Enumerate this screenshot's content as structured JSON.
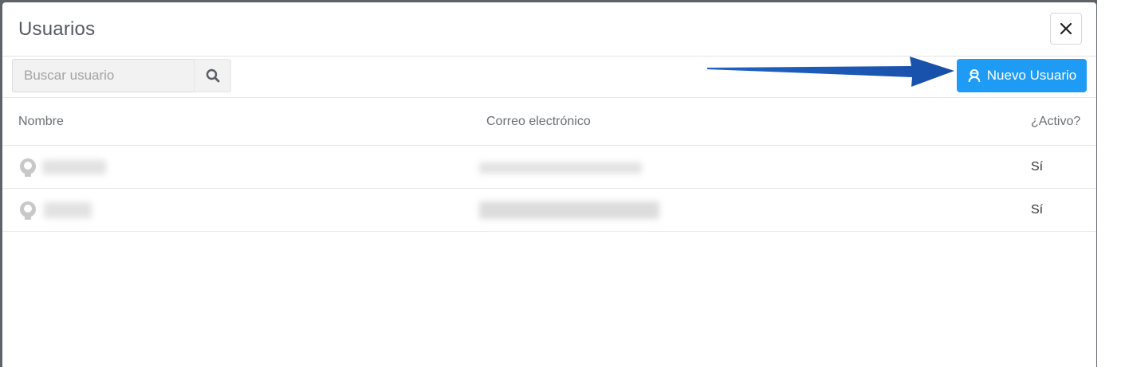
{
  "modal": {
    "title": "Usuarios",
    "close_icon": "close-icon"
  },
  "toolbar": {
    "search_placeholder": "Buscar usuario",
    "search_value": "",
    "search_icon": "search-icon",
    "new_user_label": "Nuevo Usuario",
    "new_user_icon": "user-icon",
    "accent_color": "#1e9bf5",
    "annotation": "arrow-pointing-to-new-user-button",
    "annotation_color": "#1a5cb8"
  },
  "table": {
    "columns": [
      "Nombre",
      "Correo electrónico",
      "¿Activo?"
    ],
    "rows": [
      {
        "name": "",
        "email": "",
        "active": "Sí",
        "avatar_icon": "user-avatar-icon"
      },
      {
        "name": "",
        "email": "",
        "active": "Sí",
        "avatar_icon": "user-avatar-icon"
      }
    ]
  }
}
